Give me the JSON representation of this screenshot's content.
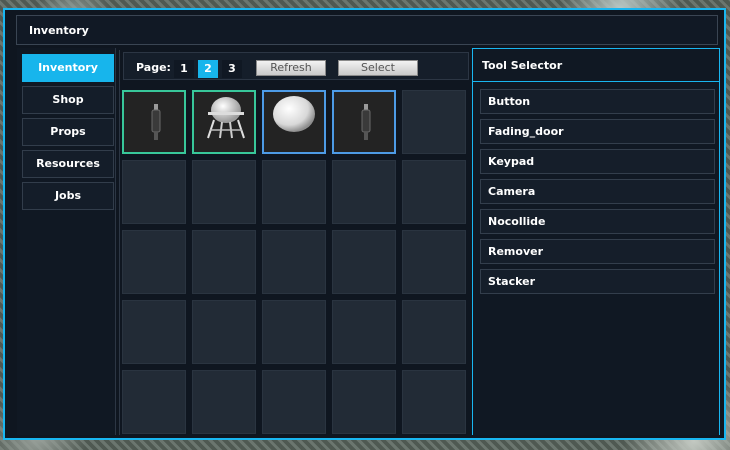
{
  "window": {
    "title": "Inventory"
  },
  "sidebar": {
    "items": [
      {
        "label": "Inventory",
        "active": true
      },
      {
        "label": "Shop",
        "active": false
      },
      {
        "label": "Props",
        "active": false
      },
      {
        "label": "Resources",
        "active": false
      },
      {
        "label": "Jobs",
        "active": false
      }
    ]
  },
  "toolbar": {
    "page_label": "Page:",
    "pages": [
      "1",
      "2",
      "3"
    ],
    "current_page": "2",
    "refresh_label": "Refresh",
    "select_label": "Select"
  },
  "inventory": {
    "columns": 5,
    "rows": 5,
    "items": [
      {
        "icon": "bottle-icon",
        "rarity_color": "#38c79a"
      },
      {
        "icon": "water-tower-icon",
        "rarity_color": "#38c79a"
      },
      {
        "icon": "sphere-icon",
        "rarity_color": "#4d9be6"
      },
      {
        "icon": "bottle-icon",
        "rarity_color": "#4d9be6"
      }
    ]
  },
  "tool_selector": {
    "title": "Tool Selector",
    "tools": [
      "Button",
      "Fading_door",
      "Keypad",
      "Camera",
      "Nocollide",
      "Remover",
      "Stacker"
    ]
  },
  "colors": {
    "accent": "#17b5ec",
    "panel": "#0f1620",
    "slot": "#222b36",
    "green_rarity": "#38c79a",
    "blue_rarity": "#4d9be6"
  }
}
